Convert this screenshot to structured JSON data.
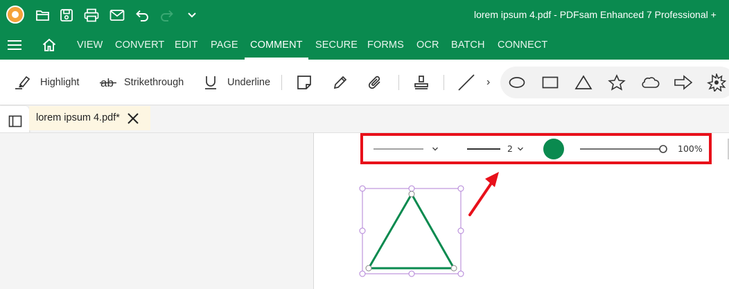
{
  "window": {
    "title": "lorem ipsum 4.pdf  -  PDFsam Enhanced 7 Professional +"
  },
  "menu": {
    "items": [
      "VIEW",
      "CONVERT",
      "EDIT",
      "PAGE",
      "COMMENT",
      "SECURE",
      "FORMS",
      "OCR",
      "BATCH",
      "CONNECT"
    ],
    "active": "COMMENT"
  },
  "ribbon": {
    "highlight_label": "Highlight",
    "strikethrough_label": "Strikethrough",
    "underline_label": "Underline",
    "more_glyph": "›"
  },
  "tab": {
    "label": "lorem ipsum 4.pdf*",
    "close_glyph": "✕"
  },
  "properties": {
    "line_width": "2",
    "color": "#0a8a4f",
    "opacity": "100%",
    "opacity_value": 1.0
  },
  "colors": {
    "brand": "#0a8a4f",
    "annotation_highlight": "#e8101a",
    "selection": "#b07fd6",
    "shape_stroke": "#0a8a4f"
  }
}
